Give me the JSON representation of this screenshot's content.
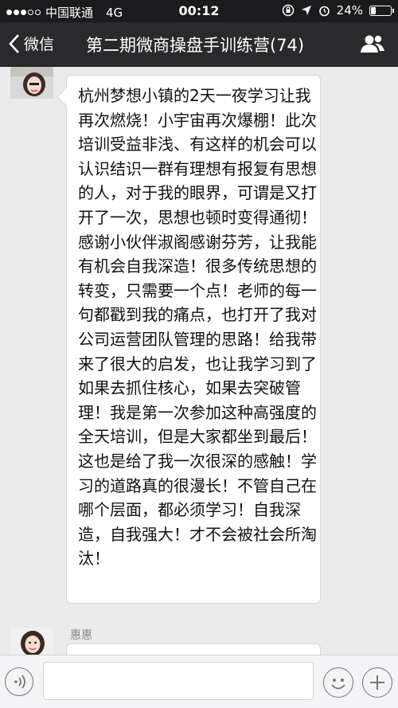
{
  "status_bar": {
    "carrier": "中国联通",
    "network": "4G",
    "time": "00:12",
    "battery": "24%",
    "battery_level": 0.24
  },
  "nav": {
    "back_label": "微信",
    "title": "第二期微商操盘手训练营(74)"
  },
  "messages": [
    {
      "text": "杭州梦想小镇的2天一夜学习让我再次燃烧！小宇宙再次爆棚！此次培训受益非浅、有这样的机会可以认识结识一群有理想有报复有思想的人，对于我的眼界，可谓是又打开了一次，思想也顿时变得通彻！感谢小伙伴淑阁感谢芬芳，让我能有机会自我深造！很多传统思想的转变，只需要一个点！老师的每一句都戳到我的痛点，也打开了我对公司运营团队管理的思路！给我带来了很大的启发，也让我学习到了如果去抓住核心，如果去突破管理！我是第一次参加这种高强度的全天培训，但是大家都坐到最后！这也是给了我一次很深的感触！学习的道路真的很漫长！不管自己在哪个层面，都必须学习！自我深造，自我强大！才不会被社会所淘汰！"
    },
    {
      "sender": "惠惠"
    }
  ],
  "icons": {
    "back": "chevron-left-icon",
    "group": "group-icon",
    "voice": "voice-icon",
    "emoji": "emoji-icon",
    "plus": "plus-icon"
  }
}
